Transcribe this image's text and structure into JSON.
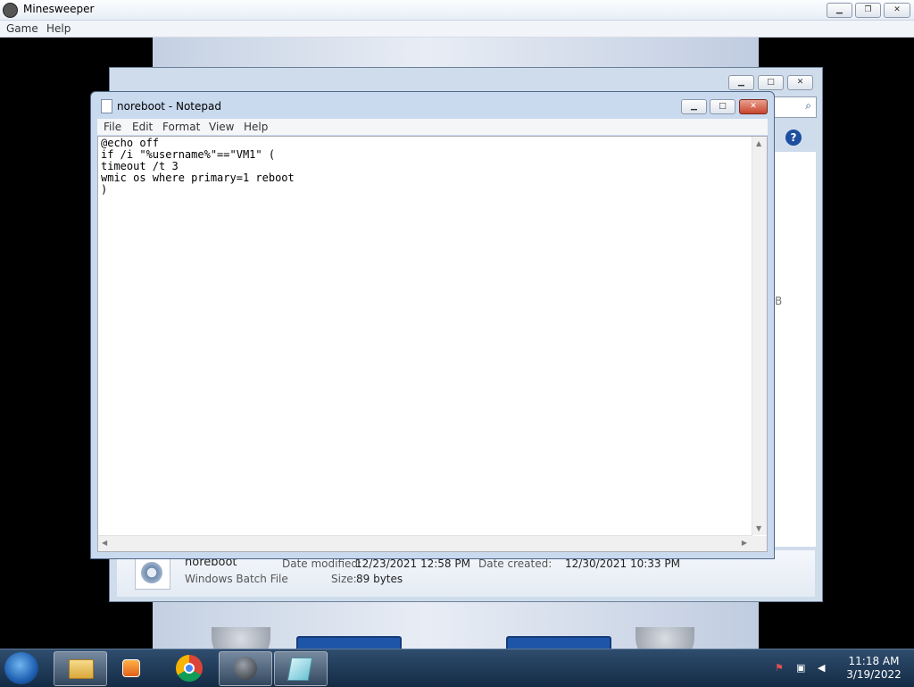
{
  "minesweeper": {
    "title": "Minesweeper",
    "menu": [
      "Game",
      "Help"
    ],
    "caption_buttons": {
      "minimize": "▁",
      "restore": "❐",
      "close": "✕"
    }
  },
  "explorer": {
    "caption_buttons": {
      "minimize": "▁",
      "maximize": "□",
      "close": "✕"
    },
    "search_icon": "⌕",
    "help_icon": "?",
    "side_glyph": "B",
    "details": {
      "name": "noreboot",
      "type": "Windows Batch File",
      "date_modified_label": "Date modified:",
      "date_modified": "12/23/2021 12:58 PM",
      "date_created_label": "Date created:",
      "date_created": "12/30/2021 10:33 PM",
      "size_label": "Size:",
      "size": "89 bytes"
    }
  },
  "notepad": {
    "title": "noreboot - Notepad",
    "menu": [
      "File",
      "Edit",
      "Format",
      "View",
      "Help"
    ],
    "caption_buttons": {
      "minimize": "▁",
      "maximize": "□",
      "close": "✕"
    },
    "content": "@echo off\nif /i \"%username%\"==\"VM1\" (\ntimeout /t 3\nwmic os where primary=1 reboot\n)"
  },
  "taskbar": {
    "items": [
      {
        "name": "windows-explorer",
        "icon": "folder-icon"
      },
      {
        "name": "media-player",
        "icon": "play-icon"
      },
      {
        "name": "chrome",
        "icon": "chrome-icon"
      },
      {
        "name": "minesweeper",
        "icon": "mine-icon"
      },
      {
        "name": "notepad",
        "icon": "notepad-icon"
      }
    ],
    "tray": {
      "time": "11:18 AM",
      "date": "3/19/2022"
    }
  }
}
